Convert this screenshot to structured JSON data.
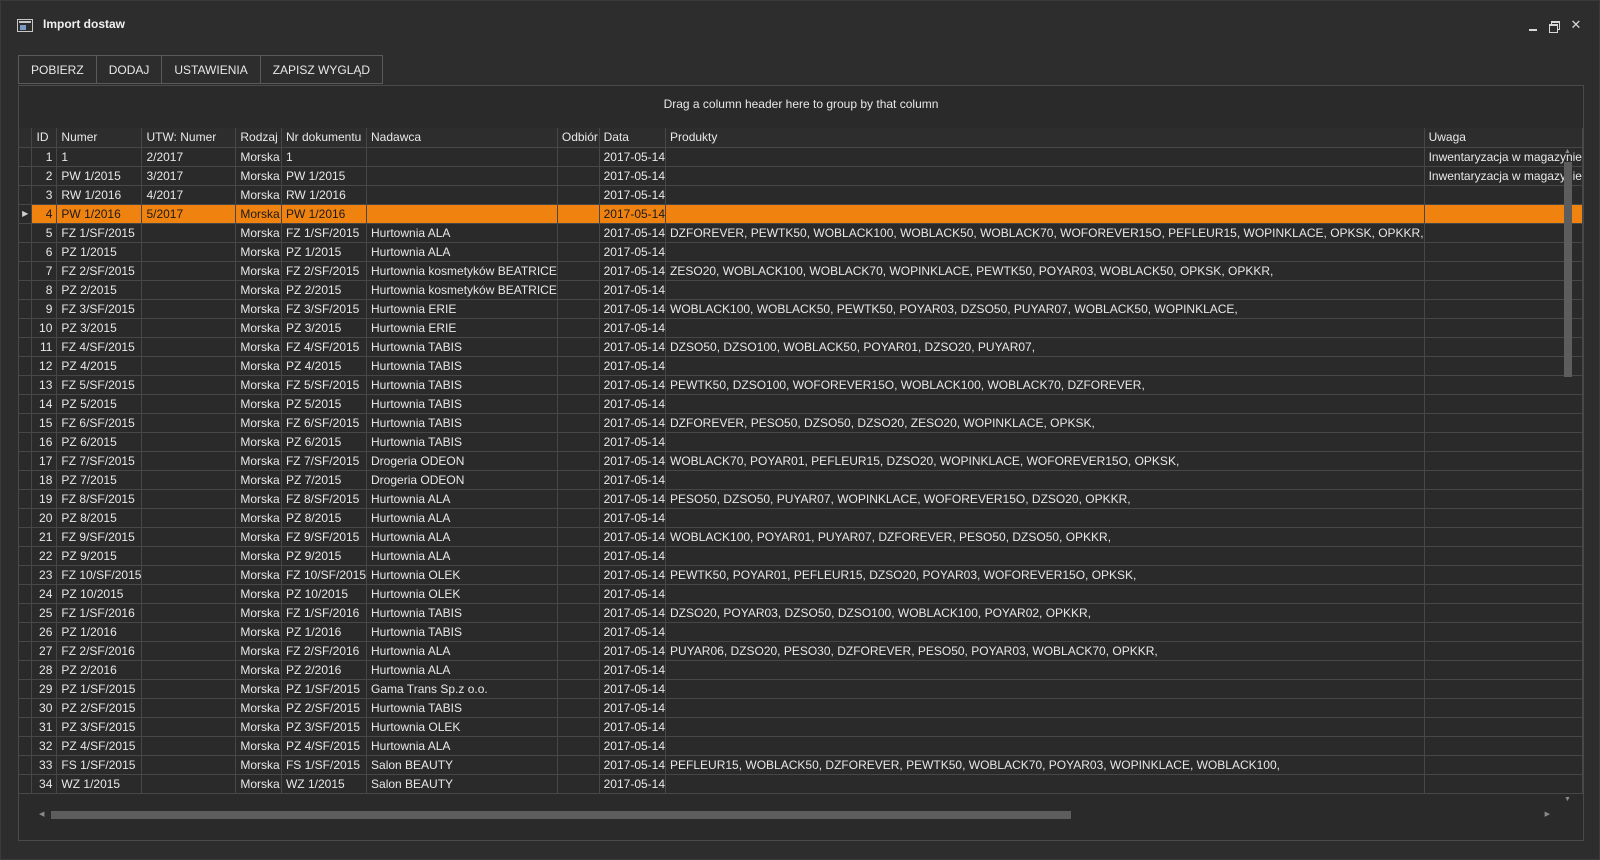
{
  "window": {
    "title": "Import dostaw"
  },
  "toolbar": {
    "buttons": [
      "POBIERZ",
      "DODAJ",
      "USTAWIENIA",
      "ZAPISZ WYGLĄD"
    ]
  },
  "grid": {
    "group_panel_text": "Drag a column header here to group by that column",
    "columns": [
      "ID",
      "Numer",
      "UTW: Numer",
      "Rodzaj",
      "Nr dokumentu",
      "Nadawca",
      "Odbiór",
      "Data",
      "Produkty",
      "Uwaga"
    ],
    "selected_row_id": "4",
    "selection_color": "#f0820f",
    "rows": [
      [
        "1",
        "1",
        "2/2017",
        "Morska",
        "1",
        "",
        "",
        "2017-05-14",
        "",
        "Inwentaryzacja w magazynie"
      ],
      [
        "2",
        "PW 1/2015",
        "3/2017",
        "Morska",
        "PW 1/2015",
        "",
        "",
        "2017-05-14",
        "",
        "Inwentaryzacja w magazynie"
      ],
      [
        "3",
        "RW 1/2016",
        "4/2017",
        "Morska",
        "RW 1/2016",
        "",
        "",
        "2017-05-14",
        "",
        ""
      ],
      [
        "4",
        "PW 1/2016",
        "5/2017",
        "Morska",
        "PW 1/2016",
        "",
        "",
        "2017-05-14",
        "",
        ""
      ],
      [
        "5",
        "FZ 1/SF/2015",
        "",
        "Morska",
        "FZ 1/SF/2015",
        "Hurtownia ALA",
        "",
        "2017-05-14",
        "DZFOREVER, PEWTK50, WOBLACK100, WOBLACK50, WOBLACK70, WOFOREVER15O, PEFLEUR15, WOPINKLACE, OPKSK, OPKKR,",
        ""
      ],
      [
        "6",
        "PZ 1/2015",
        "",
        "Morska",
        "PZ 1/2015",
        "Hurtownia ALA",
        "",
        "2017-05-14",
        "",
        ""
      ],
      [
        "7",
        "FZ 2/SF/2015",
        "",
        "Morska",
        "FZ 2/SF/2015",
        "Hurtownia kosmetyków BEATRICE",
        "",
        "2017-05-14",
        "ZESO20, WOBLACK100, WOBLACK70, WOPINKLACE, PEWTK50, POYAR03, WOBLACK50, OPKSK, OPKKR,",
        ""
      ],
      [
        "8",
        "PZ 2/2015",
        "",
        "Morska",
        "PZ 2/2015",
        "Hurtownia kosmetyków BEATRICE",
        "",
        "2017-05-14",
        "",
        ""
      ],
      [
        "9",
        "FZ 3/SF/2015",
        "",
        "Morska",
        "FZ 3/SF/2015",
        "Hurtownia ERIE",
        "",
        "2017-05-14",
        "WOBLACK100, WOBLACK50, PEWTK50, POYAR03, DZSO50, PUYAR07, WOBLACK50, WOPINKLACE,",
        ""
      ],
      [
        "10",
        "PZ 3/2015",
        "",
        "Morska",
        "PZ 3/2015",
        "Hurtownia ERIE",
        "",
        "2017-05-14",
        "",
        ""
      ],
      [
        "11",
        "FZ 4/SF/2015",
        "",
        "Morska",
        "FZ 4/SF/2015",
        "Hurtownia TABIS",
        "",
        "2017-05-14",
        "DZSO50, DZSO100, WOBLACK50, POYAR01, DZSO20, PUYAR07,",
        ""
      ],
      [
        "12",
        "PZ 4/2015",
        "",
        "Morska",
        "PZ 4/2015",
        "Hurtownia TABIS",
        "",
        "2017-05-14",
        "",
        ""
      ],
      [
        "13",
        "FZ 5/SF/2015",
        "",
        "Morska",
        "FZ 5/SF/2015",
        "Hurtownia TABIS",
        "",
        "2017-05-14",
        "PEWTK50, DZSO100, WOFOREVER15O, WOBLACK100, WOBLACK70, DZFOREVER,",
        ""
      ],
      [
        "14",
        "PZ 5/2015",
        "",
        "Morska",
        "PZ 5/2015",
        "Hurtownia TABIS",
        "",
        "2017-05-14",
        "",
        ""
      ],
      [
        "15",
        "FZ 6/SF/2015",
        "",
        "Morska",
        "FZ 6/SF/2015",
        "Hurtownia TABIS",
        "",
        "2017-05-14",
        "DZFOREVER, PESO50, DZSO50, DZSO20, ZESO20, WOPINKLACE, OPKSK,",
        ""
      ],
      [
        "16",
        "PZ 6/2015",
        "",
        "Morska",
        "PZ 6/2015",
        "Hurtownia TABIS",
        "",
        "2017-05-14",
        "",
        ""
      ],
      [
        "17",
        "FZ 7/SF/2015",
        "",
        "Morska",
        "FZ 7/SF/2015",
        "Drogeria ODEON",
        "",
        "2017-05-14",
        "WOBLACK70, POYAR01, PEFLEUR15, DZSO20, WOPINKLACE, WOFOREVER15O, OPKSK,",
        ""
      ],
      [
        "18",
        "PZ 7/2015",
        "",
        "Morska",
        "PZ 7/2015",
        "Drogeria ODEON",
        "",
        "2017-05-14",
        "",
        ""
      ],
      [
        "19",
        "FZ 8/SF/2015",
        "",
        "Morska",
        "FZ 8/SF/2015",
        "Hurtownia ALA",
        "",
        "2017-05-14",
        "PESO50, DZSO50, PUYAR07, WOPINKLACE, WOFOREVER15O, DZSO20, OPKKR,",
        ""
      ],
      [
        "20",
        "PZ 8/2015",
        "",
        "Morska",
        "PZ 8/2015",
        "Hurtownia ALA",
        "",
        "2017-05-14",
        "",
        ""
      ],
      [
        "21",
        "FZ 9/SF/2015",
        "",
        "Morska",
        "FZ 9/SF/2015",
        "Hurtownia ALA",
        "",
        "2017-05-14",
        "WOBLACK100, POYAR01, PUYAR07, DZFOREVER, PESO50, DZSO50, OPKKR,",
        ""
      ],
      [
        "22",
        "PZ 9/2015",
        "",
        "Morska",
        "PZ 9/2015",
        "Hurtownia ALA",
        "",
        "2017-05-14",
        "",
        ""
      ],
      [
        "23",
        "FZ 10/SF/2015",
        "",
        "Morska",
        "FZ 10/SF/2015",
        "Hurtownia OLEK",
        "",
        "2017-05-14",
        "PEWTK50, POYAR01, PEFLEUR15, DZSO20, POYAR03, WOFOREVER15O, OPKSK,",
        ""
      ],
      [
        "24",
        "PZ 10/2015",
        "",
        "Morska",
        "PZ 10/2015",
        "Hurtownia OLEK",
        "",
        "2017-05-14",
        "",
        ""
      ],
      [
        "25",
        "FZ 1/SF/2016",
        "",
        "Morska",
        "FZ 1/SF/2016",
        "Hurtownia TABIS",
        "",
        "2017-05-14",
        "DZSO20, POYAR03, DZSO50, DZSO100, WOBLACK100, POYAR02, OPKKR,",
        ""
      ],
      [
        "26",
        "PZ 1/2016",
        "",
        "Morska",
        "PZ 1/2016",
        "Hurtownia TABIS",
        "",
        "2017-05-14",
        "",
        ""
      ],
      [
        "27",
        "FZ 2/SF/2016",
        "",
        "Morska",
        "FZ 2/SF/2016",
        "Hurtownia ALA",
        "",
        "2017-05-14",
        "PUYAR06, DZSO20, PESO30, DZFOREVER, PESO50, POYAR03, WOBLACK70, OPKKR,",
        ""
      ],
      [
        "28",
        "PZ 2/2016",
        "",
        "Morska",
        "PZ 2/2016",
        "Hurtownia ALA",
        "",
        "2017-05-14",
        "",
        ""
      ],
      [
        "29",
        "PZ 1/SF/2015",
        "",
        "Morska",
        "PZ 1/SF/2015",
        "Gama Trans Sp.z o.o.",
        "",
        "2017-05-14",
        "",
        ""
      ],
      [
        "30",
        "PZ 2/SF/2015",
        "",
        "Morska",
        "PZ 2/SF/2015",
        "Hurtownia TABIS",
        "",
        "2017-05-14",
        "",
        ""
      ],
      [
        "31",
        "PZ 3/SF/2015",
        "",
        "Morska",
        "PZ 3/SF/2015",
        "Hurtownia OLEK",
        "",
        "2017-05-14",
        "",
        ""
      ],
      [
        "32",
        "PZ 4/SF/2015",
        "",
        "Morska",
        "PZ 4/SF/2015",
        "Hurtownia ALA",
        "",
        "2017-05-14",
        "",
        ""
      ],
      [
        "33",
        "FS 1/SF/2015",
        "",
        "Morska",
        "FS 1/SF/2015",
        "Salon BEAUTY",
        "",
        "2017-05-14",
        "PEFLEUR15, WOBLACK50, DZFOREVER, PEWTK50, WOBLACK70, POYAR03, WOPINKLACE, WOBLACK100,",
        ""
      ],
      [
        "34",
        "WZ 1/2015",
        "",
        "Morska",
        "WZ 1/2015",
        "Salon BEAUTY",
        "",
        "2017-05-14",
        "",
        ""
      ]
    ]
  },
  "icons": {
    "app": "window-icon",
    "row_indicator": "triangle-right-icon"
  }
}
